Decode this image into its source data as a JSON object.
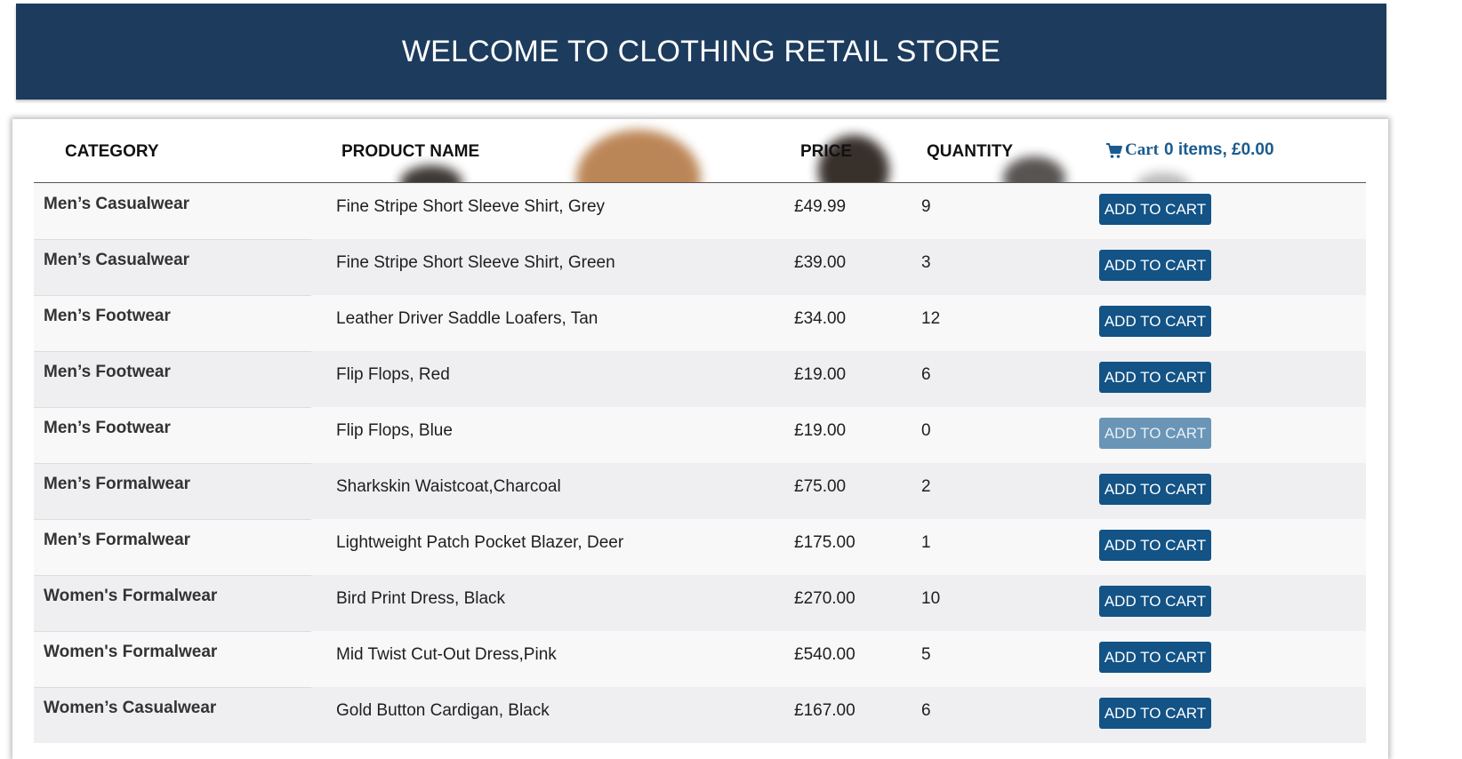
{
  "banner": {
    "title": "WELCOME TO CLOTHING RETAIL STORE"
  },
  "table": {
    "headers": {
      "category": "CATEGORY",
      "product_name": "PRODUCT NAME",
      "price": "PRICE",
      "quantity": "QUANTITY"
    },
    "cart": {
      "icon": "shopping-cart-icon",
      "label": "Cart",
      "summary": "0 items, £0.00"
    },
    "rows": [
      {
        "category": "Men’s Casualwear",
        "name": "Fine Stripe Short Sleeve Shirt, Grey",
        "price": "£49.99",
        "quantity": "9",
        "button": "ADD TO CART",
        "disabled": false
      },
      {
        "category": "Men’s Casualwear",
        "name": "Fine Stripe Short Sleeve Shirt, Green",
        "price": "£39.00",
        "quantity": "3",
        "button": "ADD TO CART",
        "disabled": false
      },
      {
        "category": "Men’s Footwear",
        "name": "Leather Driver Saddle Loafers, Tan",
        "price": "£34.00",
        "quantity": "12",
        "button": "ADD TO CART",
        "disabled": false
      },
      {
        "category": "Men’s Footwear",
        "name": "Flip Flops, Red",
        "price": "£19.00",
        "quantity": "6",
        "button": "ADD TO CART",
        "disabled": false
      },
      {
        "category": "Men’s Footwear",
        "name": "Flip Flops, Blue",
        "price": "£19.00",
        "quantity": "0",
        "button": "ADD TO CART",
        "disabled": true
      },
      {
        "category": "Men’s Formalwear",
        "name": "Sharkskin Waistcoat,Charcoal",
        "price": "£75.00",
        "quantity": "2",
        "button": "ADD TO CART",
        "disabled": false
      },
      {
        "category": "Men’s Formalwear",
        "name": "Lightweight Patch Pocket Blazer, Deer",
        "price": "£175.00",
        "quantity": "1",
        "button": "ADD TO CART",
        "disabled": false
      },
      {
        "category": "Women's Formalwear",
        "name": "Bird Print Dress, Black",
        "price": "£270.00",
        "quantity": "10",
        "button": "ADD TO CART",
        "disabled": false
      },
      {
        "category": "Women's Formalwear",
        "name": "Mid Twist Cut-Out Dress,Pink",
        "price": "£540.00",
        "quantity": "5",
        "button": "ADD TO CART",
        "disabled": false
      },
      {
        "category": "Women’s Casualwear",
        "name": "Gold Button Cardigan, Black",
        "price": "£167.00",
        "quantity": "6",
        "button": "ADD TO CART",
        "disabled": false
      }
    ]
  },
  "colors": {
    "banner_bg": "#1c3b5d",
    "button_bg": "#135386",
    "button_disabled_bg": "#6a95b6",
    "cart_text": "#1a5b8f"
  }
}
